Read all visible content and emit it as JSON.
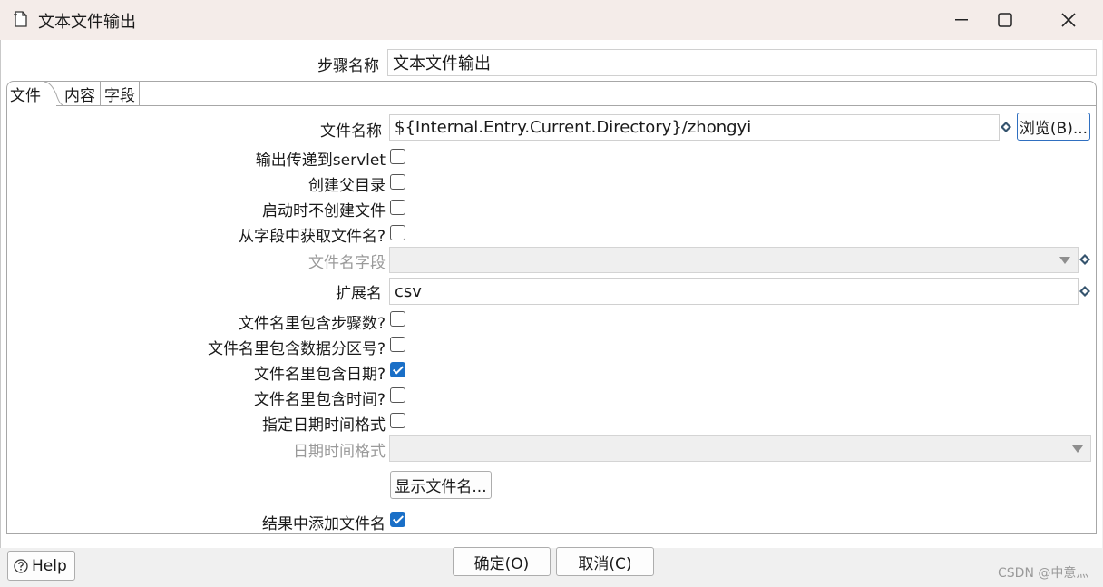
{
  "window": {
    "title": "文本文件输出",
    "icon": "text-file-output-icon"
  },
  "step_name": {
    "label": "步骤名称",
    "value": "文本文件输出"
  },
  "tabs": [
    {
      "label": "文件",
      "active": true
    },
    {
      "label": "内容",
      "active": false
    },
    {
      "label": "字段",
      "active": false
    }
  ],
  "file_tab": {
    "filename": {
      "label": "文件名称",
      "value": "${Internal.Entry.Current.Directory}/zhongyi"
    },
    "browse_label": "浏览(B)...",
    "pass_to_servlet": {
      "label": "输出传递到servlet",
      "checked": false
    },
    "create_parent_dir": {
      "label": "创建父目录",
      "checked": false
    },
    "no_create_at_start": {
      "label": "启动时不创建文件",
      "checked": false
    },
    "filename_from_field": {
      "label": "从字段中获取文件名?",
      "checked": false
    },
    "filename_field": {
      "label": "文件名字段",
      "value": "",
      "disabled": true
    },
    "extension": {
      "label": "扩展名",
      "value": "csv"
    },
    "include_stepnr": {
      "label": "文件名里包含步骤数?",
      "checked": false
    },
    "include_partition": {
      "label": "文件名里包含数据分区号?",
      "checked": false
    },
    "include_date": {
      "label": "文件名里包含日期?",
      "checked": true
    },
    "include_time": {
      "label": "文件名里包含时间?",
      "checked": false
    },
    "specify_format": {
      "label": "指定日期时间格式",
      "checked": false
    },
    "datetime_format": {
      "label": "日期时间格式",
      "value": "",
      "disabled": true
    },
    "show_filenames_label": "显示文件名...",
    "add_to_result": {
      "label": "结果中添加文件名",
      "checked": true
    }
  },
  "footer": {
    "help_label": "Help",
    "ok_label": "确定(O)",
    "cancel_label": "取消(C)"
  },
  "watermark": "CSDN @中意灬",
  "colors": {
    "accent": "#1a6fc7",
    "titlebar": "#f4ece9"
  }
}
